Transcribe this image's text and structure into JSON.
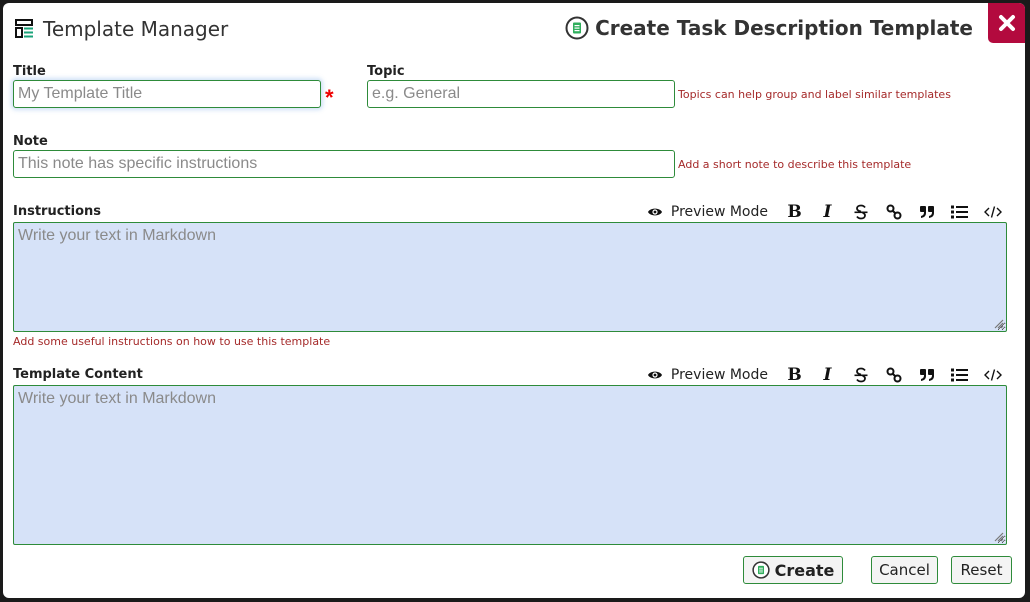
{
  "header": {
    "app_title": "Template Manager",
    "app_icon": "template-list-icon",
    "form_title": "Create Task Description Template",
    "form_icon": "document-circle-icon",
    "close_icon": "close-icon"
  },
  "fields": {
    "title": {
      "label": "Title",
      "placeholder": "My Template Title",
      "value": "",
      "required": true,
      "required_mark": "*"
    },
    "topic": {
      "label": "Topic",
      "placeholder": "e.g. General",
      "value": "",
      "hint": "Topics can help group and label similar templates"
    },
    "note": {
      "label": "Note",
      "placeholder": "This note has specific instructions",
      "value": "",
      "hint": "Add a short note to describe this template"
    },
    "instructions": {
      "label": "Instructions",
      "placeholder": "Write your text in Markdown",
      "value": "",
      "hint": "Add some useful instructions on how to use this template"
    },
    "template_content": {
      "label": "Template Content",
      "placeholder": "Write your text in Markdown",
      "value": ""
    }
  },
  "editor_toolbar": {
    "preview_label": "Preview Mode",
    "preview_icon": "eye-icon",
    "bold_label": "B",
    "italic_label": "I",
    "buttons": [
      "bold",
      "italic",
      "strikethrough",
      "link",
      "quote",
      "bullet-list",
      "code"
    ]
  },
  "footer": {
    "create_label": "Create",
    "cancel_label": "Cancel",
    "reset_label": "Reset"
  },
  "colors": {
    "close_bg": "#b30a3e",
    "border_green": "#2e8b3a",
    "hint_red": "#a52a2a",
    "editor_bg": "#d6e2f8",
    "icon_teal": "#1aa37a"
  }
}
